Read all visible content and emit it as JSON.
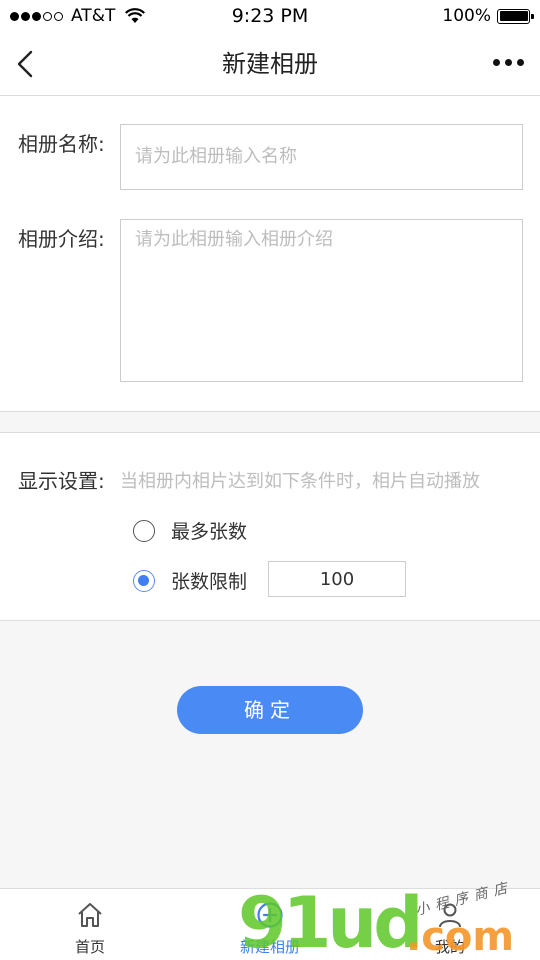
{
  "status_bar": {
    "carrier": "AT&T",
    "time": "9:23 PM",
    "battery": "100%",
    "signal_bars_filled": 3,
    "signal_bars_total": 5
  },
  "nav": {
    "title": "新建相册",
    "back_icon": "chevron-left-icon",
    "more_icon": "more-dots-icon"
  },
  "form": {
    "name_label": "相册名称:",
    "name_placeholder": "请为此相册输入名称",
    "intro_label": "相册介绍:",
    "intro_placeholder": "请为此相册输入相册介绍"
  },
  "display_settings": {
    "label": "显示设置:",
    "hint": "当相册内相片达到如下条件时，相片自动播放",
    "options": [
      {
        "label": "最多张数",
        "checked": false
      },
      {
        "label": "张数限制",
        "checked": true
      }
    ],
    "limit_value": "100"
  },
  "confirm_button": {
    "label": "确定"
  },
  "tab_bar": {
    "tabs": [
      {
        "label": "首页",
        "icon": "home-icon",
        "active": false
      },
      {
        "label": "新建相册",
        "icon": "add-circle-icon",
        "active": true
      },
      {
        "label": "我的",
        "icon": "user-icon",
        "active": false
      }
    ]
  },
  "watermark": {
    "main": "91ud",
    "suffix": ".com",
    "sub": "小程序商店"
  },
  "colors": {
    "accent": "#4a8af4",
    "placeholder": "#bdbdbd",
    "border": "#dcdcdc",
    "background": "#f6f6f6"
  }
}
